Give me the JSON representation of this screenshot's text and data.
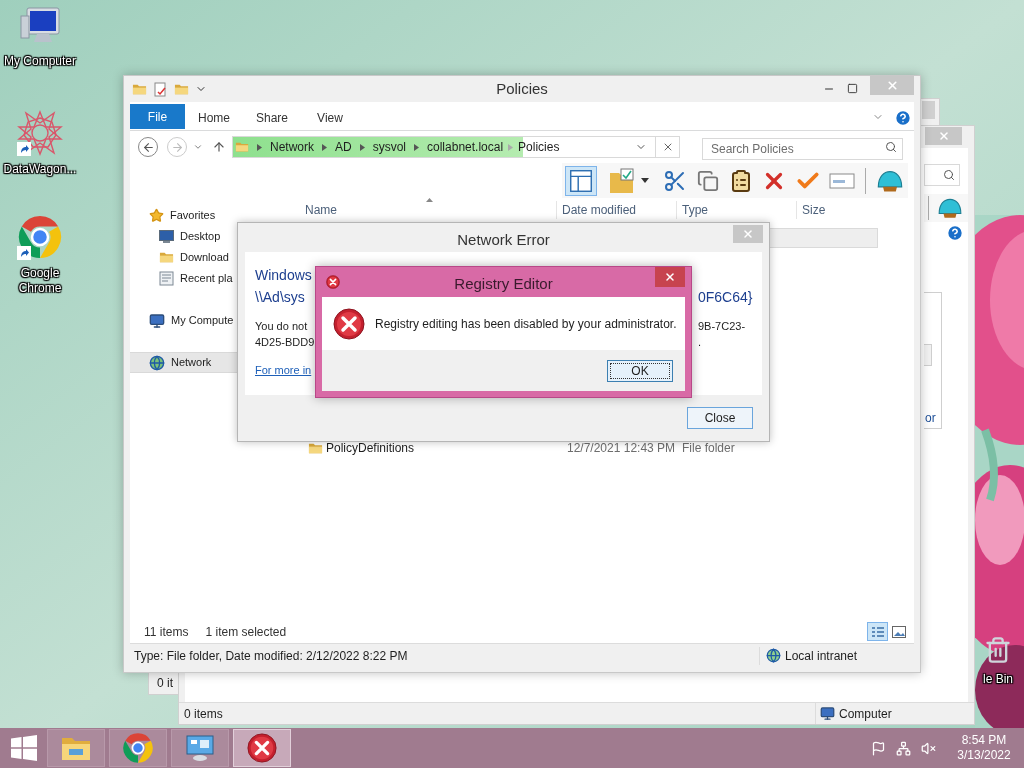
{
  "desktop": {
    "icons": [
      {
        "label": "My Computer",
        "kind": "computer",
        "shortcut": false
      },
      {
        "label": "DataWagon...",
        "kind": "star",
        "shortcut": true
      },
      {
        "label": "Google Chrome",
        "kind": "browser",
        "shortcut": true
      }
    ],
    "recycle_bin": {
      "label": "le Bin"
    }
  },
  "back_windows": [
    {
      "status_text": "0 it"
    },
    {
      "status_items": "0 items",
      "status_location": "Computer",
      "side_text": "or"
    }
  ],
  "explorer": {
    "title": "Policies",
    "ribbon_tabs": [
      {
        "label": "File",
        "kind": "menu"
      },
      {
        "label": "Home",
        "kind": "tab"
      },
      {
        "label": "Share",
        "kind": "tab"
      },
      {
        "label": "View",
        "kind": "tab"
      }
    ],
    "address": {
      "crumbs": [
        "Network",
        "AD",
        "sysvol",
        "collabnet.local",
        "Policies"
      ],
      "level": 0.65
    },
    "search": {
      "placeholder": "Search Policies"
    },
    "toolbar": {
      "preview_pane": true
    },
    "columns": [
      "Name",
      "Date modified",
      "Type",
      "Size"
    ],
    "nav": [
      {
        "label": "Favorites",
        "kind": "favorites",
        "selected": false,
        "children": [
          {
            "label": "Desktop",
            "kind": "desktop",
            "selected": false
          },
          {
            "label": "Download",
            "kind": "downloads",
            "selected": false
          },
          {
            "label": "Recent pla",
            "kind": "recent",
            "selected": false
          }
        ]
      },
      {
        "label": "My Compute",
        "kind": "computer",
        "selected": false
      },
      {
        "label": "Network",
        "kind": "network",
        "selected": true
      }
    ],
    "rows": [
      {
        "selected": true
      },
      {
        "name": "PolicyDefinitions",
        "date_modified": "12/7/2021 12:43 PM",
        "type": "File folder",
        "selected": false
      }
    ],
    "item_count": "11 items",
    "selection_count": "1 item selected",
    "view_buttons": [
      {
        "kind": "details",
        "selected": true
      },
      {
        "kind": "large-icons",
        "selected": false
      }
    ],
    "status_bar": {
      "details": "Type: File folder, Date modified: 2/12/2022 8:22 PM",
      "zone": "Local intranet"
    }
  },
  "network_error": {
    "title": "Network Error",
    "heading_left": [
      "Windows",
      "\\\\Ad\\sys"
    ],
    "heading_right": "0F6C64}",
    "body_left": [
      "You do not",
      "4D25-BDD9"
    ],
    "body_right": [
      "9B-7C23-",
      "."
    ],
    "link": "For more in",
    "button": "Close"
  },
  "registry_error": {
    "title": "Registry Editor",
    "message": "Registry editing has been disabled by your administrator.",
    "button": "OK"
  },
  "taskbar": {
    "apps": [
      {
        "kind": "explorer",
        "active": false
      },
      {
        "kind": "browser",
        "active": false
      },
      {
        "kind": "control-panel",
        "active": false
      },
      {
        "kind": "error",
        "active": true
      }
    ],
    "time": "8:54 PM",
    "date": "3/13/2022"
  }
}
